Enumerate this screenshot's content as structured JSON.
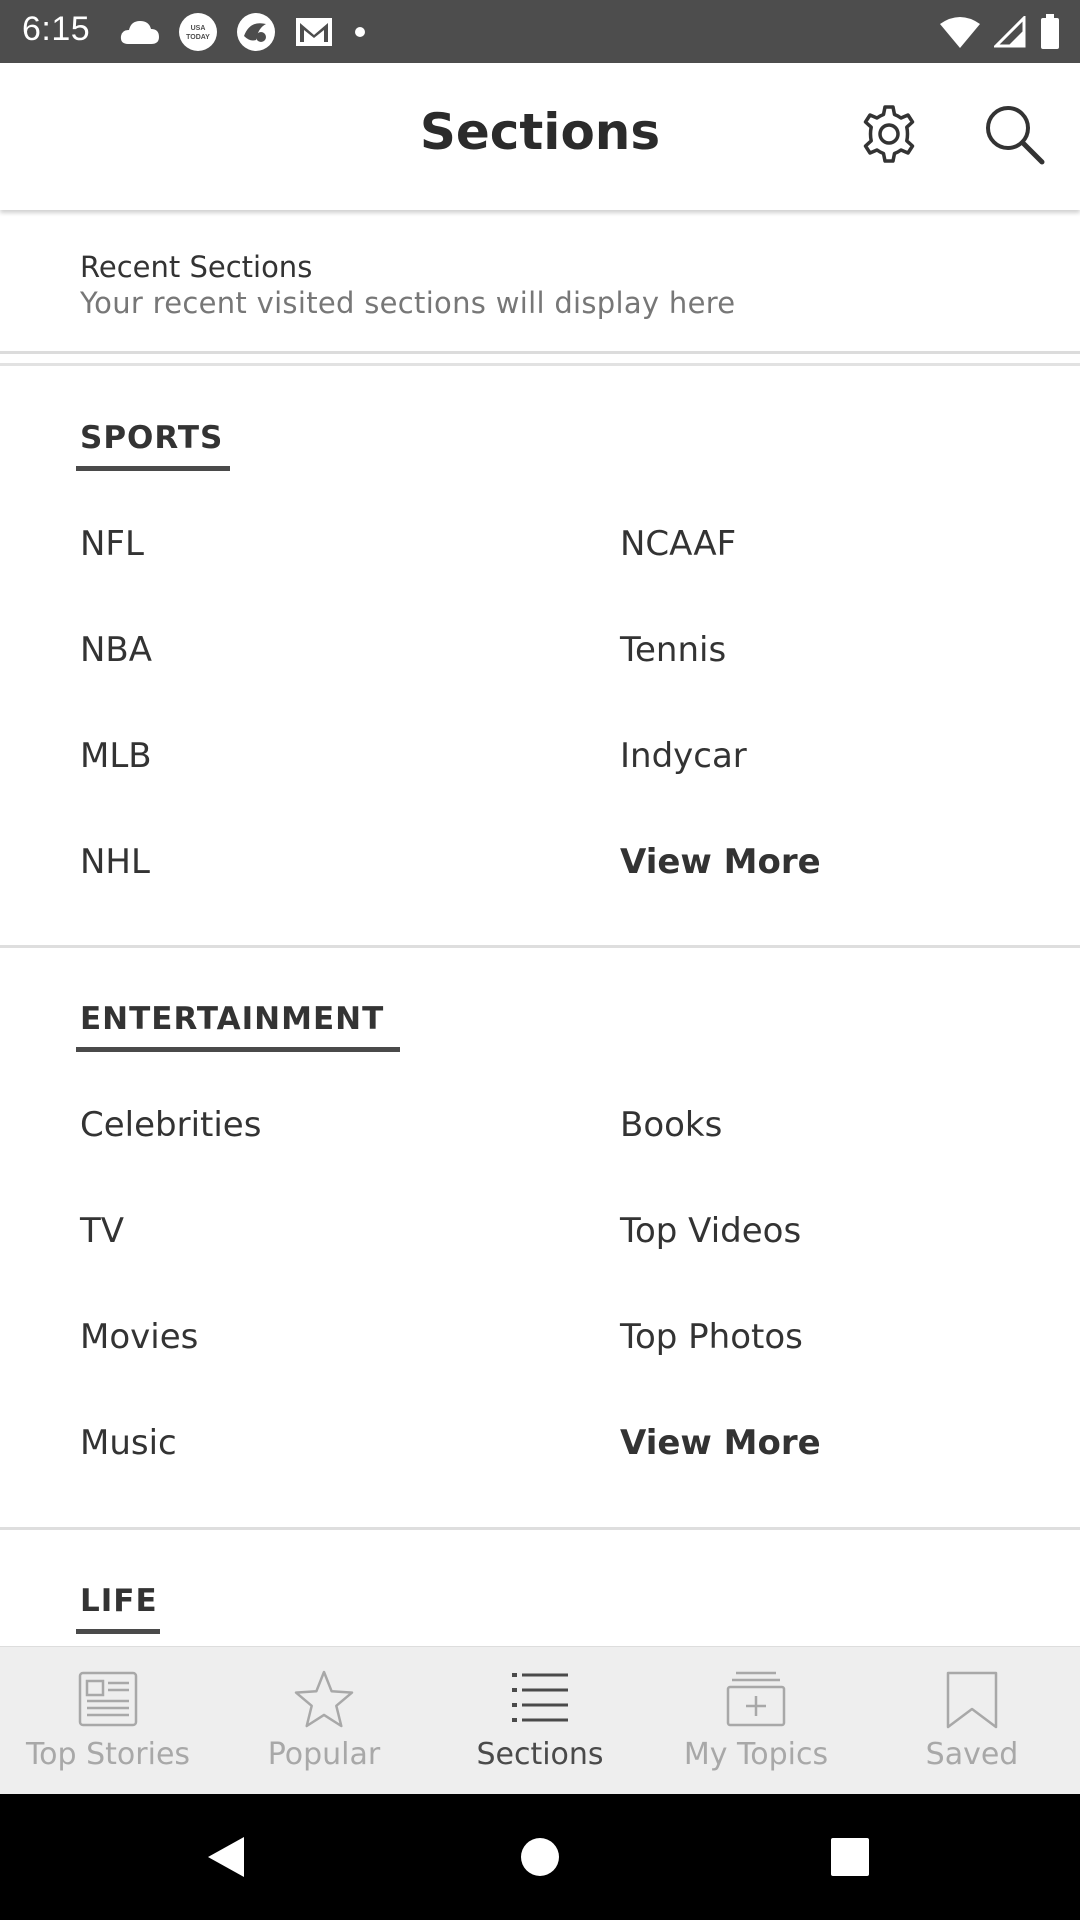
{
  "status_bar": {
    "time": "6:15",
    "left_icons": [
      "cloud-icon",
      "usa-today-icon",
      "app-icon",
      "gmail-icon",
      "dot-icon"
    ],
    "right_icons": [
      "wifi-icon",
      "signal-icon",
      "battery-icon"
    ],
    "usa_today_logo_text": "USA TODAY"
  },
  "header": {
    "title": "Sections"
  },
  "recent": {
    "title": "Recent Sections",
    "subtitle": "Your recent visited sections will display here"
  },
  "sports": {
    "heading": "SPORTS",
    "left": [
      "NFL",
      "NBA",
      "MLB",
      "NHL"
    ],
    "right": [
      "NCAAF",
      "Tennis",
      "Indycar"
    ],
    "view_more": "View More"
  },
  "entertainment": {
    "heading": "ENTERTAINMENT",
    "left": [
      "Celebrities",
      "TV",
      "Movies",
      "Music"
    ],
    "right": [
      "Books",
      "Top Videos",
      "Top Photos"
    ],
    "view_more": "View More"
  },
  "life": {
    "heading": "LIFE"
  },
  "bottom_nav": {
    "active": "Sections",
    "items": [
      {
        "label": "Top Stories",
        "icon": "newspaper-icon"
      },
      {
        "label": "Popular",
        "icon": "star-icon"
      },
      {
        "label": "Sections",
        "icon": "list-icon"
      },
      {
        "label": "My Topics",
        "icon": "add-topic-icon"
      },
      {
        "label": "Saved",
        "icon": "bookmark-icon"
      }
    ]
  },
  "colors": {
    "status_bar": "#4d4d4d",
    "nav_background": "#eeeeee",
    "nav_active": "#4a4a4a",
    "nav_inactive": "#a8a8a8",
    "text": "#333333"
  }
}
